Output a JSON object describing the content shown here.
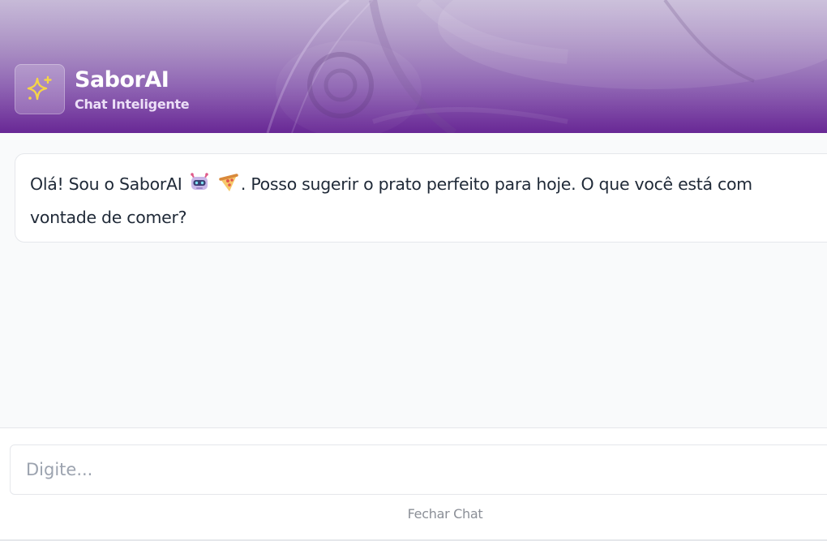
{
  "header": {
    "title": "SaborAI",
    "subtitle": "Chat Inteligente",
    "logo_icon": "sparkles-icon",
    "accent_color": "#6e2c9a",
    "sparkle_color": "#f5d547"
  },
  "messages": [
    {
      "sender": "bot",
      "text_before": "Olá! Sou o SaborAI",
      "emojis": [
        "robot-emoji",
        "pizza-emoji"
      ],
      "text_line1_after": ". Posso sugerir o prato perfeito para hoje. O que você está com",
      "text_line2": "vontade de comer?"
    }
  ],
  "composer": {
    "placeholder": "Digite...",
    "value": ""
  },
  "footer": {
    "close_label": "Fechar Chat"
  }
}
